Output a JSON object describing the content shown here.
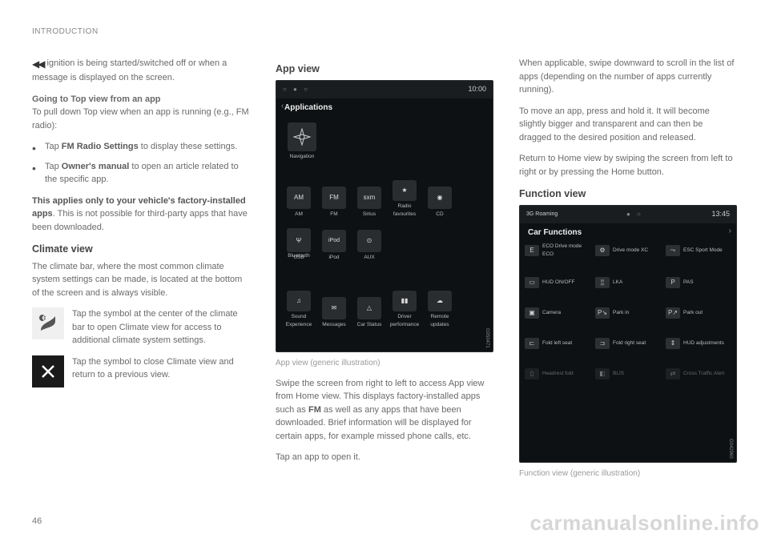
{
  "header": {
    "running": "INTRODUCTION"
  },
  "page_number": "46",
  "watermark": "carmanualsonline.info",
  "col1": {
    "cont": "◀◀",
    "p1": "ignition is being started/switched off or when a message is displayed on the screen.",
    "sub1": "Going to Top view from an app",
    "p2": "To pull down Top view when an app is running (e.g., FM radio):",
    "bullets": [
      {
        "pre": "Tap ",
        "bold": "FM Radio Settings",
        "post": " to display these settings."
      },
      {
        "pre": "Tap ",
        "bold": "Owner's manual",
        "post": " to open an article related to the specific app."
      }
    ],
    "p3a": "This applies only to your vehicle's factory-installed apps",
    "p3b": ". This is not possible for third-party apps that have been downloaded.",
    "h_climate": "Climate view",
    "p4": "The climate bar, where the most common climate system settings can be made, is located at the bottom of the screen and is always visible.",
    "icon1_txt": "Tap the symbol at the center of the climate bar to open Climate view for access to additional climate system settings.",
    "icon2_txt": "Tap the symbol to close Climate view and return to a previous view."
  },
  "col2": {
    "h_app": "App view",
    "shot": {
      "time": "10:00",
      "title": "Applications",
      "dots": "○ ● ○",
      "apps_row0": [
        "Navigation"
      ],
      "apps_row1": [
        "AM",
        "FM",
        "Sirius",
        "Radio favourites",
        "CD",
        "Bluetooth"
      ],
      "apps_row2": [
        "USB",
        "iPod",
        "AUX"
      ],
      "apps_row3": [
        "Sound Experience",
        "Messages",
        "Car Status",
        "Driver performance",
        "Remote updates"
      ],
      "code": "G050471"
    },
    "caption": "App view (generic illustration)",
    "p1a": "Swipe the screen from right to left to access App view from Home view. This displays factory-installed apps such as ",
    "p1b": "FM",
    "p1c": " as well as any apps that have been downloaded. Brief information will be displayed for certain apps, for example missed phone calls, etc.",
    "p2": "Tap an app to open it."
  },
  "col3": {
    "p1": "When applicable, swipe downward to scroll in the list of apps (depending on the number of apps currently running).",
    "p2": "To move an app, press and hold it. It will become slightly bigger and transparent and can then be dragged to the desired position and released.",
    "p3": "Return to Home view by swiping the screen from left to right or by pressing the Home button.",
    "h_func": "Function view",
    "shot": {
      "status": "3G Roaming",
      "time": "13:45",
      "title": "Car Functions",
      "dots": "● ○",
      "rows": [
        [
          "ECO Drive mode ECO",
          "Drive mode XC",
          "ESC Sport Mode"
        ],
        [
          "HUD ON/OFF",
          "LKA",
          "PAS"
        ],
        [
          "Camera",
          "Park in",
          "Park out"
        ],
        [
          "Fold left seat",
          "Fold right seat",
          "HUD adjustments"
        ],
        [
          "Headrest fold",
          "BLIS",
          "Cross Traffic Alert"
        ]
      ],
      "code": "G042960"
    },
    "caption": "Function view (generic illustration)"
  }
}
